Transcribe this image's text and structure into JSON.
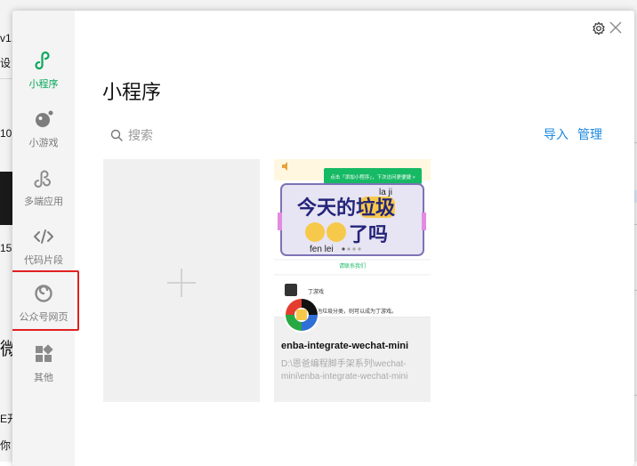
{
  "background": {
    "fragments": [
      "v1.",
      "设",
      "10",
      "15",
      "微",
      "E开",
      "你"
    ]
  },
  "dialog": {
    "sidebar": {
      "items": [
        {
          "label": "小程序",
          "icon": "miniprogram-icon",
          "active": true
        },
        {
          "label": "小游戏",
          "icon": "minigame-icon",
          "active": false
        },
        {
          "label": "多端应用",
          "icon": "multiplatform-icon",
          "active": false
        },
        {
          "label": "代码片段",
          "icon": "code-snippet-icon",
          "active": false
        },
        {
          "label": "公众号网页",
          "icon": "official-account-icon",
          "active": false
        },
        {
          "label": "其他",
          "icon": "other-icon",
          "active": false
        }
      ]
    },
    "title": "小程序",
    "search": {
      "placeholder": "搜索"
    },
    "actions": {
      "import": "导入",
      "manage": "管理"
    },
    "project": {
      "name": "enba-integrate-wechat-mini",
      "path": "D:\\恩爸编程脚手架系列\\wechat-mini\\enba-integrate-wechat-mini",
      "preview": {
        "banner": "点击「添加小程序」，下次访问更便捷 >",
        "pinyin_top": "la   ji",
        "headline_1": "今天的垃圾",
        "headline_2": "了吗",
        "pinyin_bottom": "fen   lei",
        "link": "请联系我们",
        "sub_title": "丁游戏",
        "sub_text": "点击…属于其他垃圾分类，则可以成为丁游戏。"
      }
    },
    "colors": {
      "accent": "#07a75b",
      "link": "#1a88e0",
      "highlight": "#e02020"
    }
  }
}
